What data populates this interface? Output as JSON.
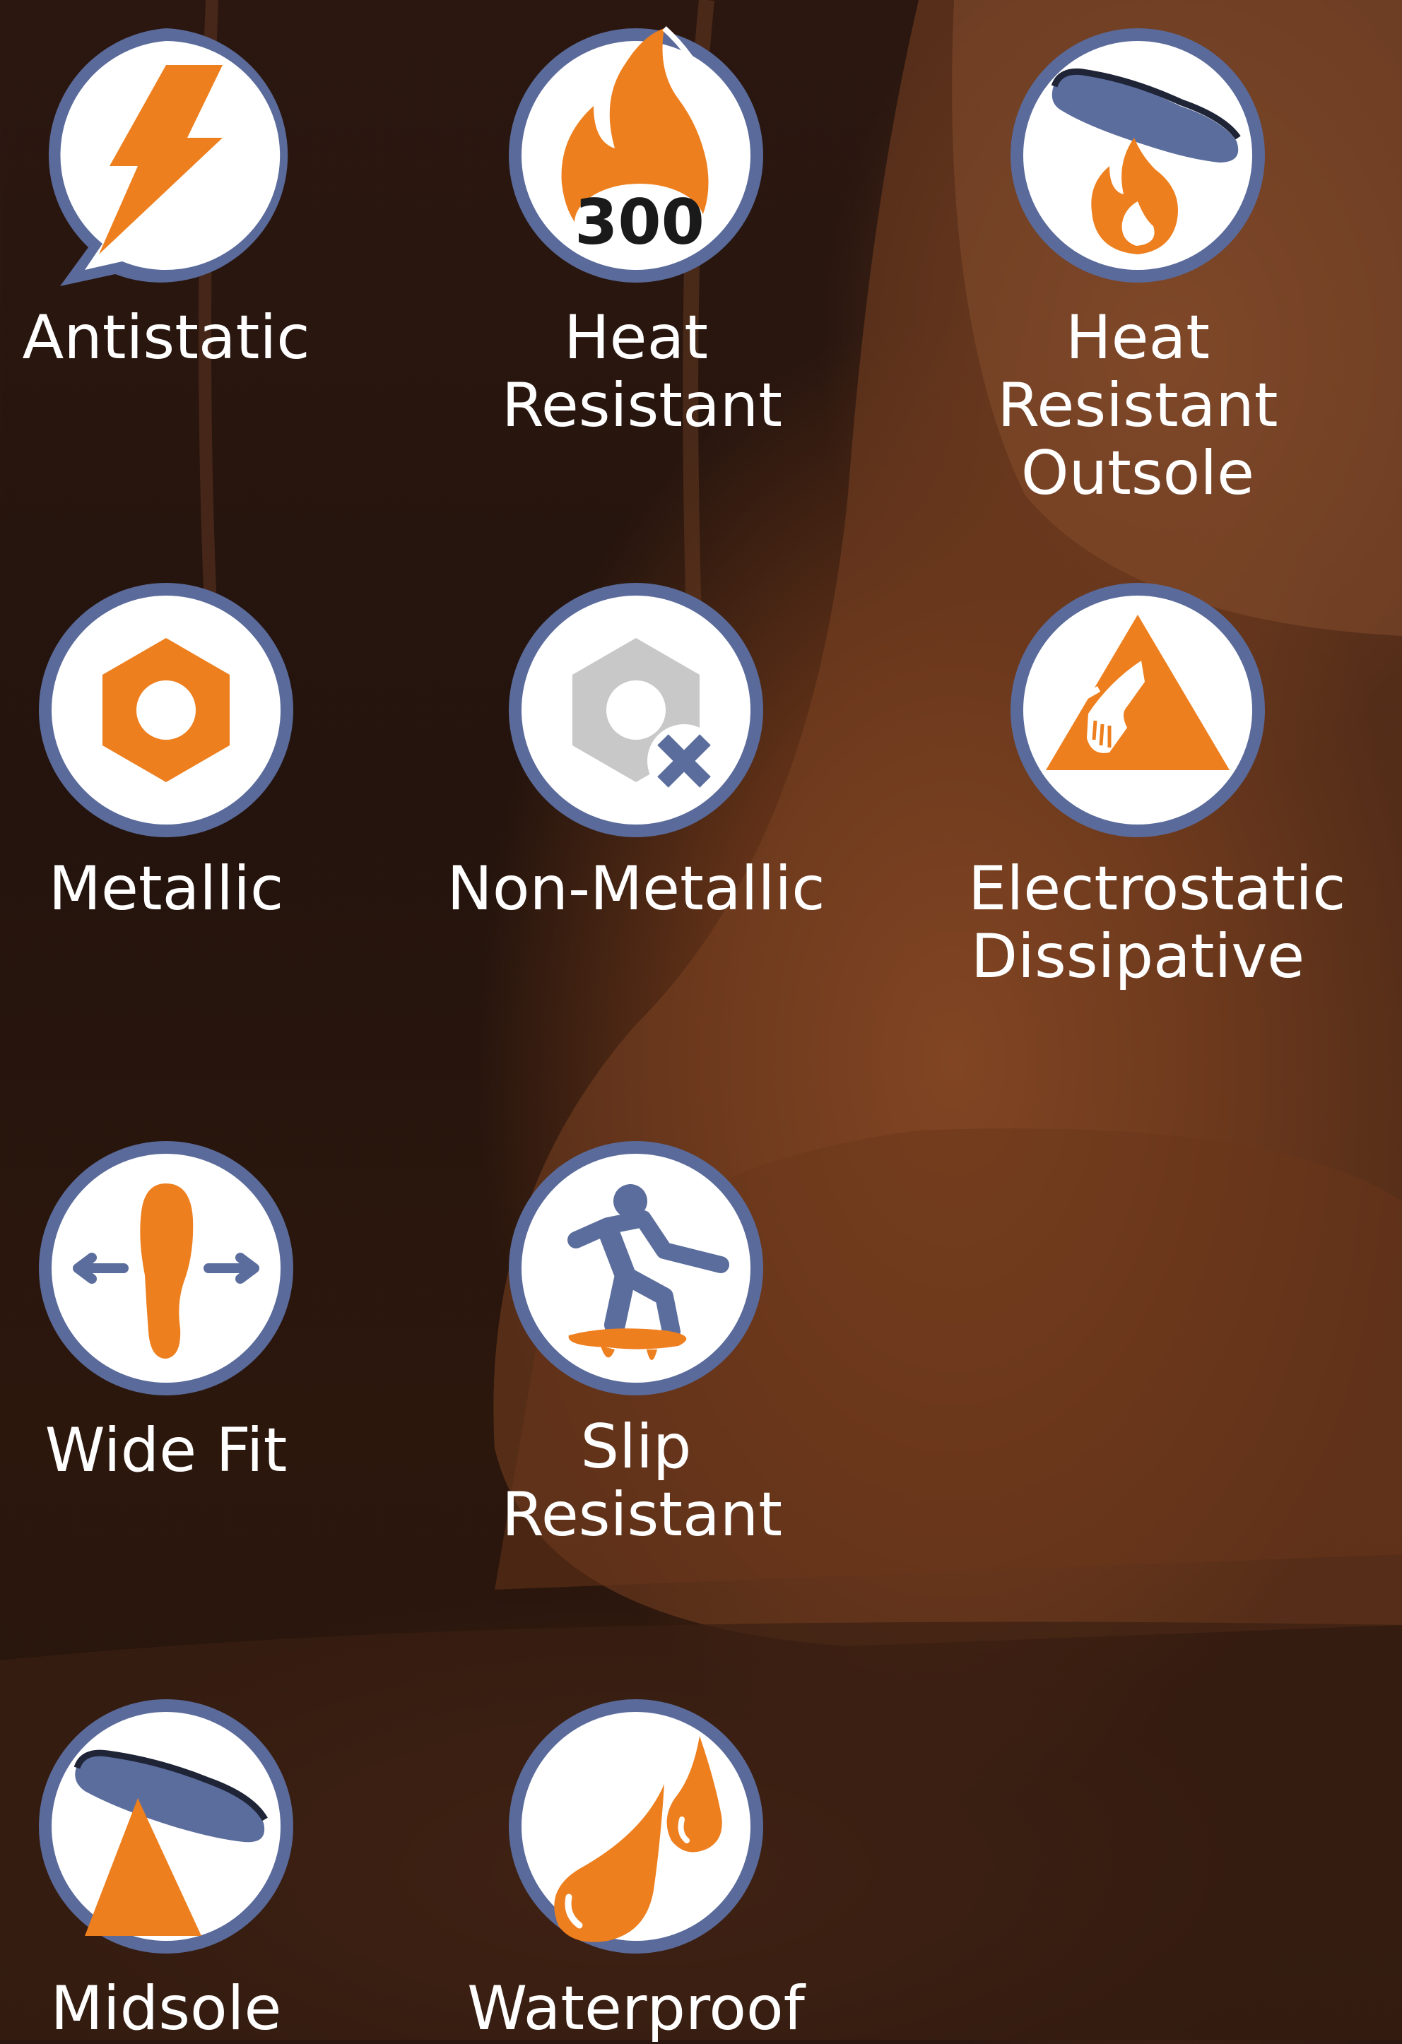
{
  "features": [
    {
      "id": "antistatic",
      "label": "Antistatic",
      "icon": "lightning-bolt-icon"
    },
    {
      "id": "heat-resistant",
      "label": "Heat Resistant",
      "icon": "flame-300-icon",
      "badge": "300"
    },
    {
      "id": "heat-resistant-outsole",
      "label": "Heat Resistant Outsole",
      "icon": "outsole-flame-icon"
    },
    {
      "id": "metallic",
      "label": "Metallic",
      "icon": "hex-nut-icon"
    },
    {
      "id": "non-metallic",
      "label": "Non-Metallic",
      "icon": "hex-nut-cross-icon"
    },
    {
      "id": "electrostatic-dissipative",
      "label": "Electrostatic Dissipative",
      "icon": "esd-triangle-icon"
    },
    {
      "id": "wide-fit",
      "label": "Wide Fit",
      "icon": "footprint-arrows-icon"
    },
    {
      "id": "slip-resistant",
      "label": "Slip Resistant",
      "icon": "slipping-person-icon"
    },
    {
      "id": "midsole",
      "label": "Midsole",
      "icon": "midsole-spike-icon"
    },
    {
      "id": "waterproof",
      "label": "Waterproof",
      "icon": "water-drops-icon"
    }
  ],
  "colors": {
    "orange": "#ee7f1e",
    "ring_blue": "#5a6a9a",
    "icon_blue": "#5b6d9d",
    "nut_grey": "#c8c8c8",
    "text": "#ffffff"
  }
}
